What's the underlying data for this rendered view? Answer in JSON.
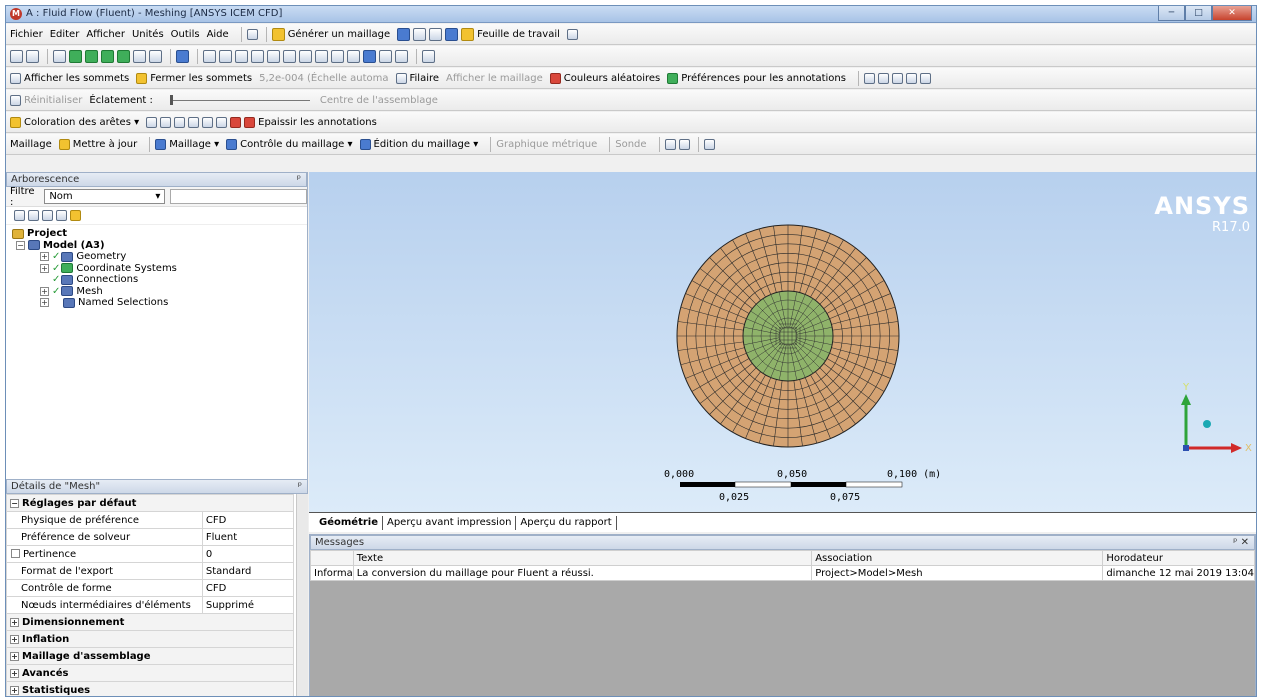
{
  "window": {
    "title": "A : Fluid Flow (Fluent) - Meshing [ANSYS ICEM CFD]",
    "min": "─",
    "max": "□",
    "close": "✕"
  },
  "menu": [
    "Fichier",
    "Editer",
    "Afficher",
    "Unités",
    "Outils",
    "Aide"
  ],
  "toolbar1": {
    "generate": "Générer un maillage",
    "worksheet": "Feuille de travail"
  },
  "toolbar3": {
    "show_vertices": "Afficher les sommets",
    "close_vertices": "Fermer les sommets",
    "scale": "5,2e-004 (Échelle automa",
    "wireframe": "Filaire",
    "show_mesh": "Afficher le maillage",
    "random_colors": "Couleurs aléatoires",
    "annotation_prefs": "Préférences pour les annotations"
  },
  "toolbar4": {
    "reset": "Réinitialiser",
    "explode": "Éclatement :",
    "assembly_center": "Centre de l'assemblage"
  },
  "toolbar5": {
    "edge_coloring": "Coloration des arêtes",
    "thicken": "Epaissir les annotations"
  },
  "toolbar6": {
    "mesh": "Maillage",
    "update": "Mettre à jour",
    "mesh_menu": "Maillage",
    "mesh_control": "Contrôle du maillage",
    "mesh_edit": "Édition du maillage",
    "metric_graph": "Graphique métrique",
    "probe": "Sonde"
  },
  "tree": {
    "header": "Arborescence",
    "filter_label": "Filtre :",
    "filter_value": "Nom",
    "items": [
      {
        "label": "Project",
        "level": 0
      },
      {
        "label": "Model (A3)",
        "level": 1
      },
      {
        "label": "Geometry",
        "level": 2
      },
      {
        "label": "Coordinate Systems",
        "level": 2
      },
      {
        "label": "Connections",
        "level": 2
      },
      {
        "label": "Mesh",
        "level": 2
      },
      {
        "label": "Named Selections",
        "level": 2
      }
    ]
  },
  "details": {
    "header": "Détails de \"Mesh\"",
    "sections": [
      {
        "title": "Réglages par défaut",
        "rows": [
          {
            "k": "Physique de préférence",
            "v": "CFD"
          },
          {
            "k": "Préférence de solveur",
            "v": "Fluent"
          },
          {
            "k": "Pertinence",
            "v": "0"
          },
          {
            "k": "Format de l'export",
            "v": "Standard"
          },
          {
            "k": "Contrôle de forme",
            "v": "CFD"
          },
          {
            "k": "Nœuds intermédiaires d'éléments",
            "v": "Supprimé"
          }
        ]
      },
      {
        "title": "Dimensionnement"
      },
      {
        "title": "Inflation"
      },
      {
        "title": "Maillage d'assemblage"
      },
      {
        "title": "Avancés"
      },
      {
        "title": "Statistiques"
      }
    ]
  },
  "viewport": {
    "brand": "ANSYS",
    "version": "R17.0",
    "scale_labels": [
      "0,000",
      "0,050",
      "0,100 (m)"
    ],
    "scale_labels_low": [
      "0,025",
      "0,075"
    ],
    "axis_y": "Y",
    "axis_x": "X",
    "colors": {
      "outer": "#d4a373",
      "inner": "#8fb36a",
      "background_top": "#b7d0ee"
    }
  },
  "tabs": [
    "Géométrie",
    "Aperçu avant impression",
    "Aperçu du rapport"
  ],
  "messages": {
    "header": "Messages",
    "columns": [
      "",
      "Texte",
      "Association",
      "Horodateur"
    ],
    "rows": [
      [
        "Informa",
        "La conversion du maillage pour Fluent a réussi.",
        "Project>Model>Mesh",
        "dimanche 12 mai 2019 13:04"
      ]
    ]
  }
}
